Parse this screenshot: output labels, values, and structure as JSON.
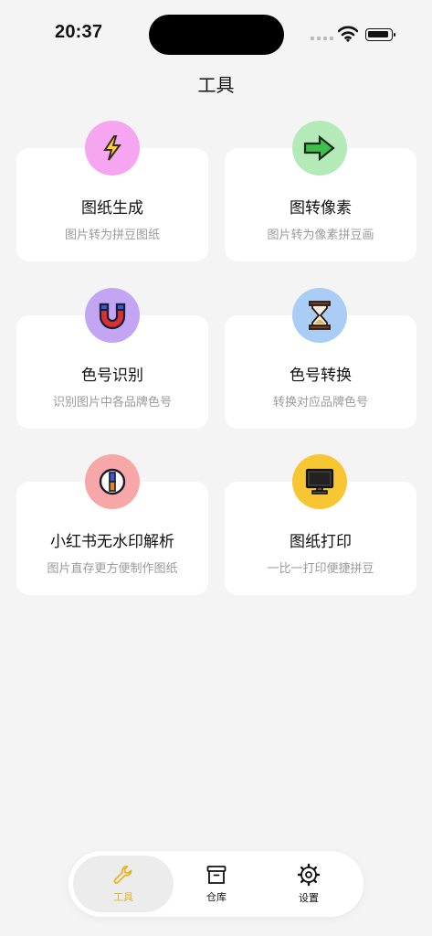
{
  "status": {
    "time": "20:37"
  },
  "header": {
    "title": "工具"
  },
  "tools": [
    {
      "title": "图纸生成",
      "subtitle": "图片转为拼豆图纸",
      "icon": "lightning-icon",
      "color": "#f6a6f0"
    },
    {
      "title": "图转像素",
      "subtitle": "图片转为像素拼豆画",
      "icon": "arrow-right-icon",
      "color": "#b4eab8"
    },
    {
      "title": "色号识别",
      "subtitle": "识别图片中各品牌色号",
      "icon": "magnet-icon",
      "color": "#c2a6f4"
    },
    {
      "title": "色号转换",
      "subtitle": "转换对应品牌色号",
      "icon": "hourglass-icon",
      "color": "#aacdf5"
    },
    {
      "title": "小红书无水印解析",
      "subtitle": "图片直存更方便制作图纸",
      "icon": "compass-icon",
      "color": "#f7a7a7"
    },
    {
      "title": "图纸打印",
      "subtitle": "一比一打印便捷拼豆",
      "icon": "monitor-icon",
      "color": "#f8c632"
    }
  ],
  "tabbar": {
    "items": [
      {
        "label": "工具",
        "icon": "wrench-icon",
        "active": true
      },
      {
        "label": "仓库",
        "icon": "archive-icon",
        "active": false
      },
      {
        "label": "设置",
        "icon": "gear-icon",
        "active": false
      }
    ],
    "active_color": "#e8b421"
  }
}
